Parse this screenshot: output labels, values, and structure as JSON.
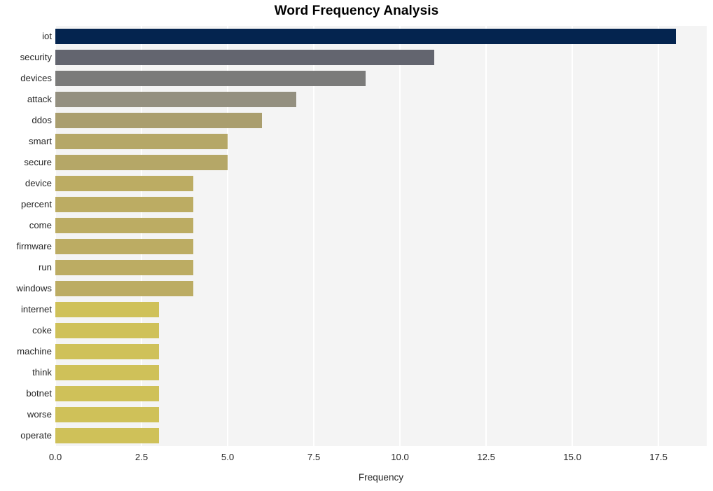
{
  "chart_data": {
    "type": "bar",
    "orientation": "horizontal",
    "title": "Word Frequency Analysis",
    "xlabel": "Frequency",
    "ylabel": "",
    "categories": [
      "iot",
      "security",
      "devices",
      "attack",
      "ddos",
      "smart",
      "secure",
      "device",
      "percent",
      "come",
      "firmware",
      "run",
      "windows",
      "internet",
      "coke",
      "machine",
      "think",
      "botnet",
      "worse",
      "operate"
    ],
    "values": [
      18,
      11,
      9,
      7,
      6,
      5,
      5,
      4,
      4,
      4,
      4,
      4,
      4,
      3,
      3,
      3,
      3,
      3,
      3,
      3
    ],
    "bar_colors": [
      "#04244f",
      "#63656f",
      "#7b7b7a",
      "#949080",
      "#aa9e6e",
      "#b5a767",
      "#b5a767",
      "#bcac63",
      "#bcac63",
      "#bcac63",
      "#bcac63",
      "#bcac63",
      "#bcac63",
      "#cfc159",
      "#cfc159",
      "#cfc159",
      "#cfc159",
      "#cfc159",
      "#cfc159",
      "#cfc159"
    ],
    "xticks": [
      "0.0",
      "2.5",
      "5.0",
      "7.5",
      "10.0",
      "12.5",
      "15.0",
      "17.5"
    ],
    "xtick_values": [
      0,
      2.5,
      5,
      7.5,
      10,
      12.5,
      15,
      17.5
    ],
    "xlim": [
      0,
      18.9
    ],
    "grid": true,
    "legend": "none",
    "plot_background": "#f4f4f4",
    "gridline_color": "#ffffff",
    "figure_background": "#ffffff",
    "text_color": "#262626"
  }
}
